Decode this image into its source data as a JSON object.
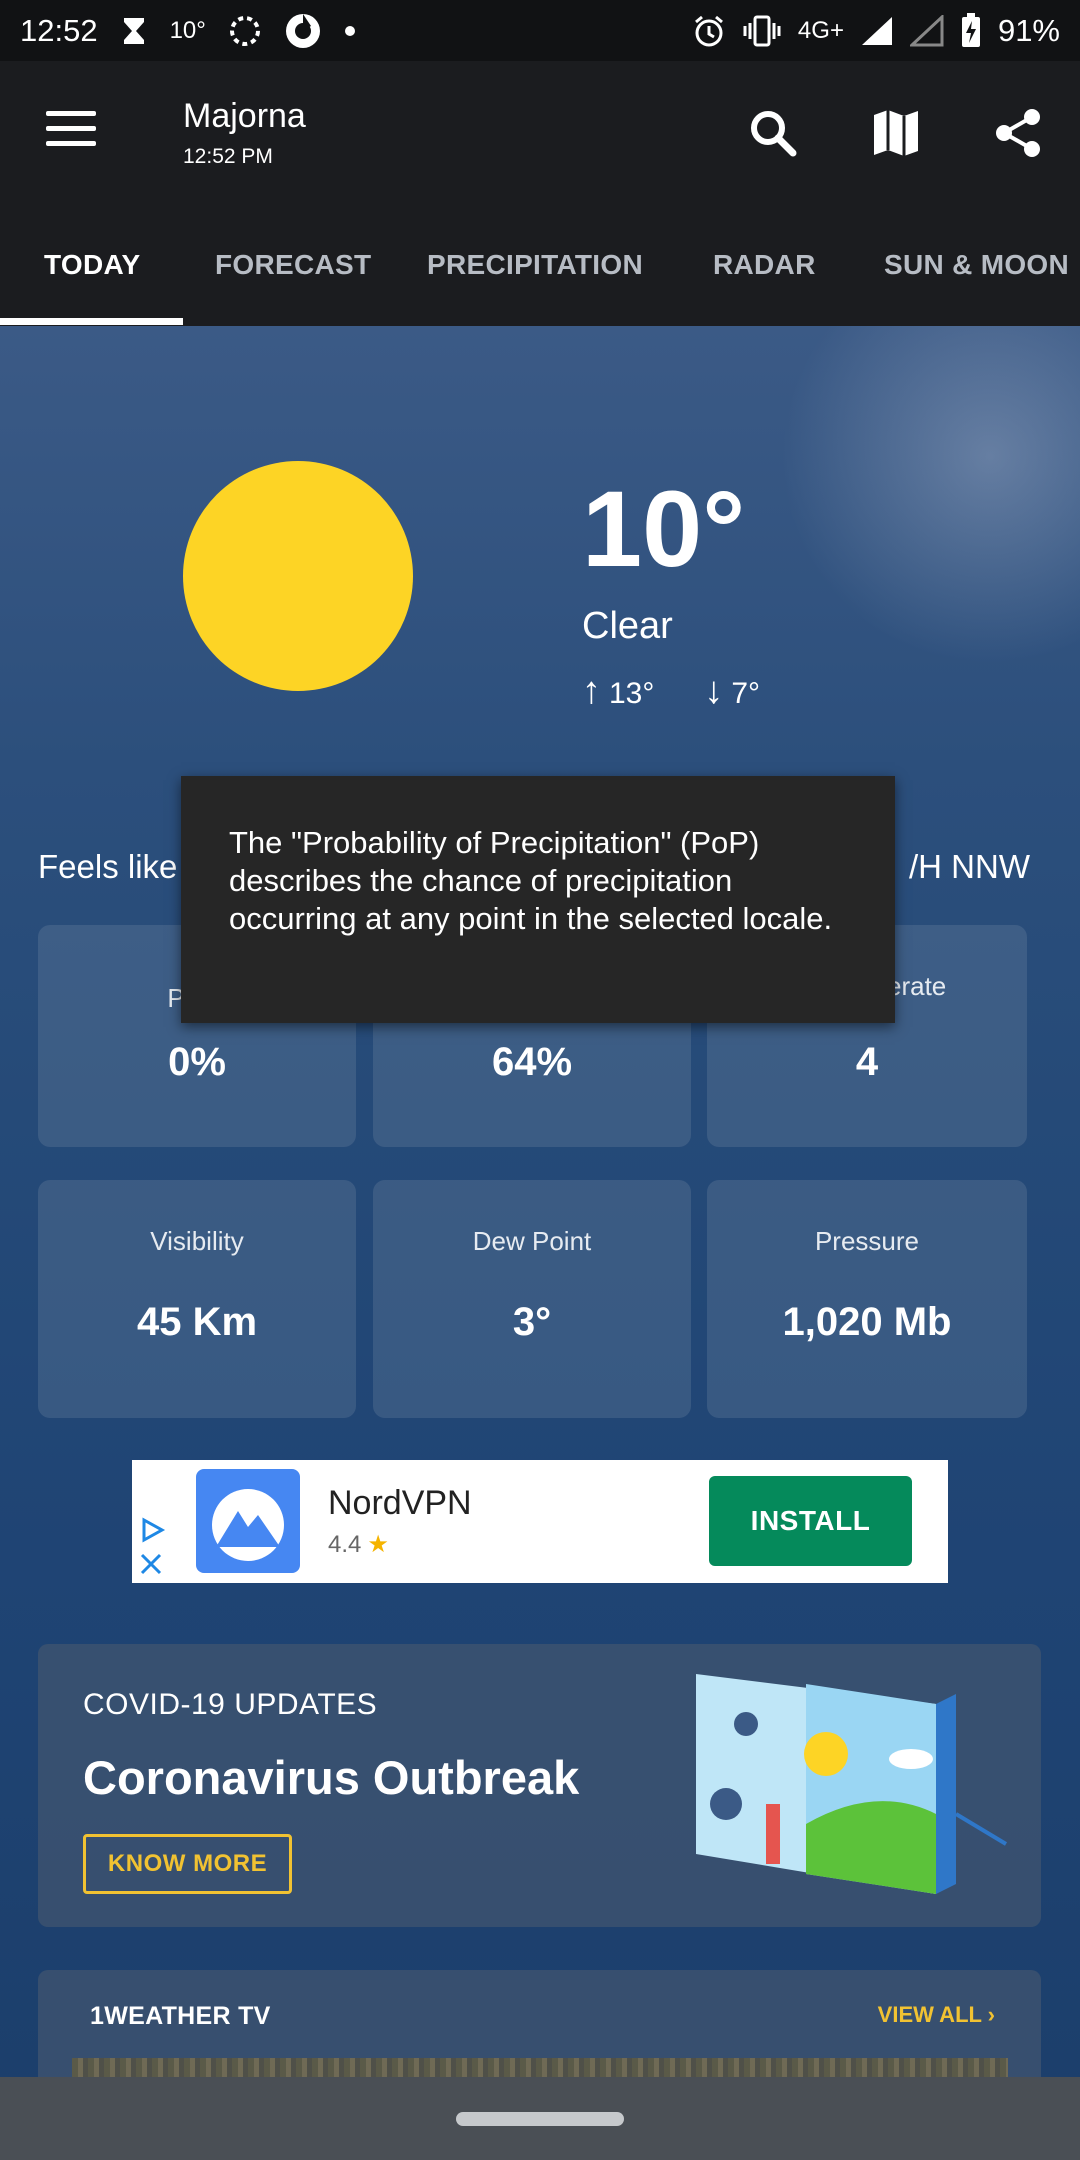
{
  "status_bar": {
    "time": "12:52",
    "temp": "10°",
    "network": "4G+",
    "battery": "91%"
  },
  "app_bar": {
    "location": "Majorna",
    "updated_time": "12:52 PM"
  },
  "tabs": [
    {
      "label": "TODAY",
      "active": true
    },
    {
      "label": "FORECAST",
      "active": false
    },
    {
      "label": "PRECIPITATION",
      "active": false
    },
    {
      "label": "RADAR",
      "active": false
    },
    {
      "label": "SUN & MOON",
      "active": false
    }
  ],
  "current": {
    "temperature": "10°",
    "condition": "Clear",
    "high": "13°",
    "low": "7°",
    "feels_like": "Feels like",
    "wind": "/H NNW"
  },
  "details": [
    {
      "label": "Preci",
      "value": "0%"
    },
    {
      "label": "",
      "value": "64%"
    },
    {
      "label": "erate",
      "value": "4"
    },
    {
      "label": "Visibility",
      "value": "45 Km"
    },
    {
      "label": "Dew Point",
      "value": "3°"
    },
    {
      "label": "Pressure",
      "value": "1,020 Mb"
    }
  ],
  "tooltip": {
    "text": "The \"Probability of Precipitation\" (PoP) describes the chance of precipitation occurring at any point in the selected locale."
  },
  "ad": {
    "name": "NordVPN",
    "rating": "4.4",
    "button": "INSTALL"
  },
  "covid": {
    "kicker": "COVID-19 UPDATES",
    "title": "Coronavirus Outbreak",
    "button": "KNOW MORE"
  },
  "tv": {
    "title": "1WEATHER TV",
    "view_all": "VIEW ALL"
  },
  "colors": {
    "sun": "#fdd425",
    "accent_yellow": "#f1c232",
    "install_green": "#058a5b",
    "appbar": "#1b1c1f"
  }
}
